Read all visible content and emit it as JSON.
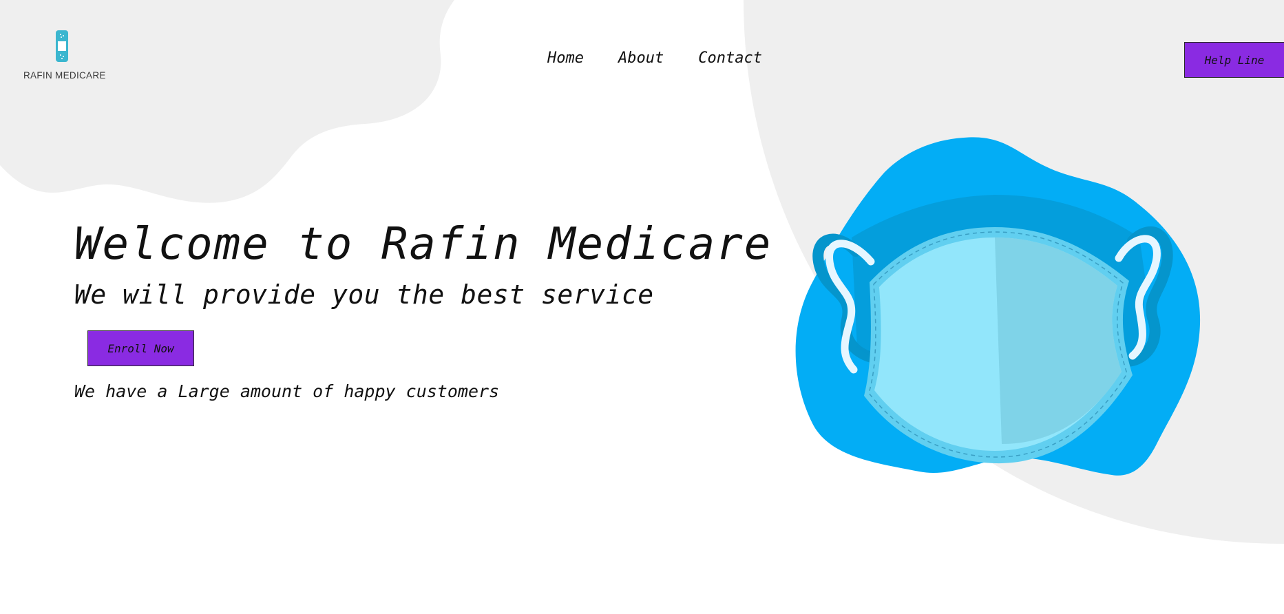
{
  "brand": {
    "name": "RAFIN MEDICARE",
    "logo_icon": "bandage-icon"
  },
  "nav": {
    "items": [
      {
        "label": "Home"
      },
      {
        "label": "About"
      },
      {
        "label": "Contact"
      }
    ]
  },
  "header": {
    "help_label": "Help Line"
  },
  "hero": {
    "title": "Welcome to Rafin Medicare",
    "subtitle": "We will provide you the best service",
    "cta_label": "Enroll Now",
    "note": "We have a Large amount of happy customers",
    "illustration": "face-mask-icon"
  },
  "colors": {
    "button": "#8a2be2",
    "blob": "#03adf5",
    "mask_light": "#92e6fb",
    "mask_shadow": "#7fd3e8",
    "background_shape": "#efefef"
  }
}
